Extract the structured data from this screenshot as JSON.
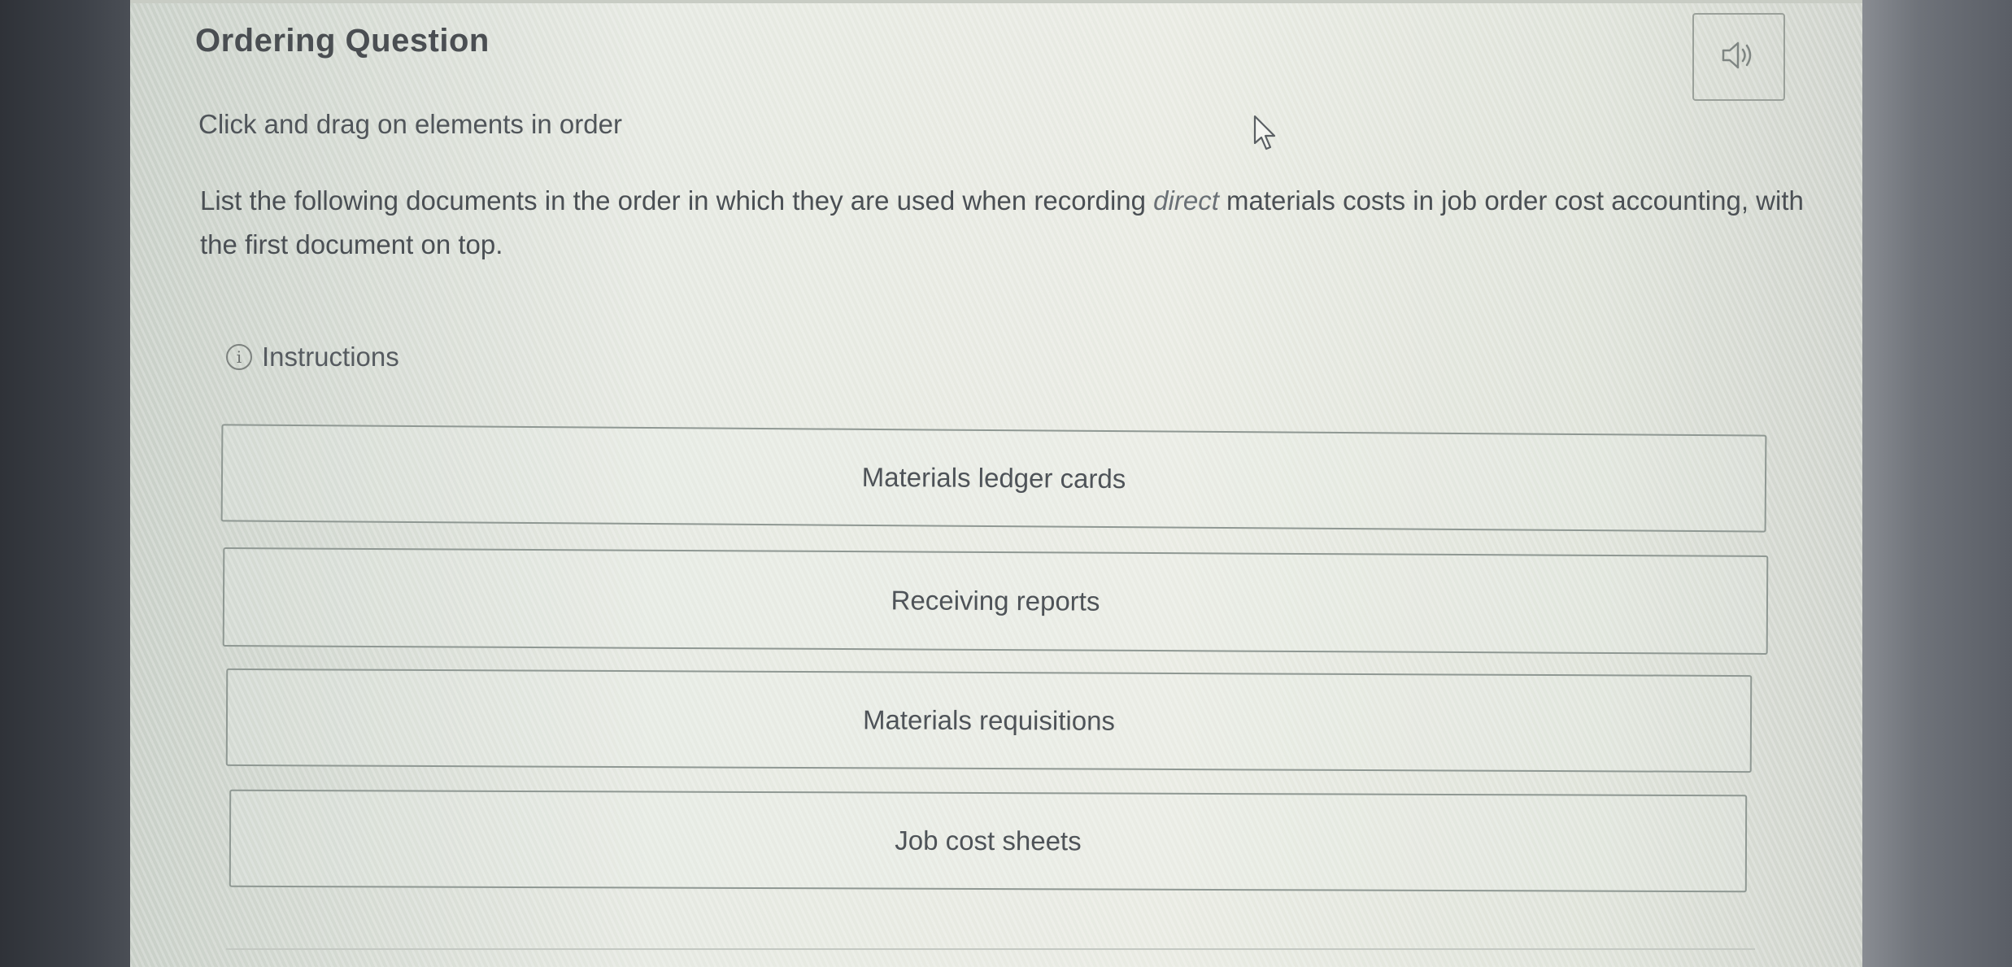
{
  "title": "Ordering Question",
  "subtitle": "Click and drag on elements in order",
  "question": {
    "before": "List the following documents in the order in which they are used when recording ",
    "emphasis": "direct",
    "after": " materials costs in job order cost accounting, with the first document on top."
  },
  "instructions_label": "Instructions",
  "audio_icon": "speaker-icon",
  "items": [
    {
      "label": "Materials ledger cards"
    },
    {
      "label": "Receiving reports"
    },
    {
      "label": "Materials requisitions"
    },
    {
      "label": "Job cost sheets"
    }
  ],
  "colors": {
    "panel_bg": "#e6e9e2",
    "text": "#4a4f54",
    "border": "#8f9893"
  }
}
